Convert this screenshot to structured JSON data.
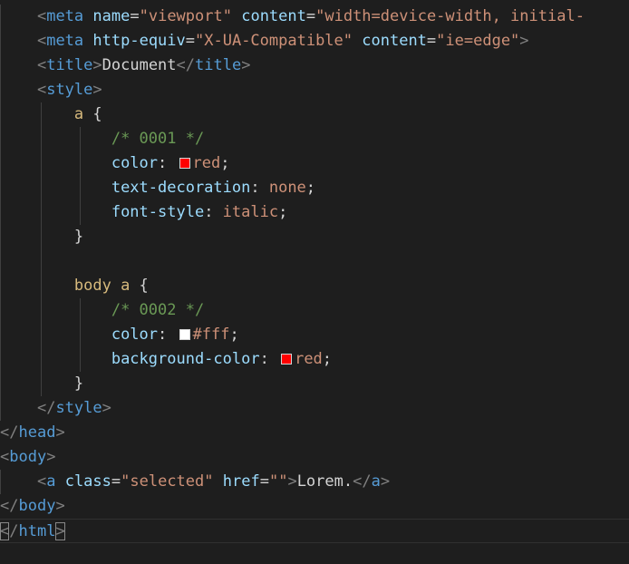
{
  "lines": [
    {
      "indent": 2,
      "tokens": [
        {
          "t": "<",
          "c": "punc"
        },
        {
          "t": "meta",
          "c": "tag"
        },
        {
          "t": " "
        },
        {
          "t": "name",
          "c": "attr"
        },
        {
          "t": "=",
          "c": "eq"
        },
        {
          "t": "\"viewport\"",
          "c": "str"
        },
        {
          "t": " "
        },
        {
          "t": "content",
          "c": "attr"
        },
        {
          "t": "=",
          "c": "eq"
        },
        {
          "t": "\"width=device-width, initial-",
          "c": "str"
        }
      ]
    },
    {
      "indent": 2,
      "tokens": [
        {
          "t": "<",
          "c": "punc"
        },
        {
          "t": "meta",
          "c": "tag"
        },
        {
          "t": " "
        },
        {
          "t": "http-equiv",
          "c": "attr"
        },
        {
          "t": "=",
          "c": "eq"
        },
        {
          "t": "\"X-UA-Compatible\"",
          "c": "str"
        },
        {
          "t": " "
        },
        {
          "t": "content",
          "c": "attr"
        },
        {
          "t": "=",
          "c": "eq"
        },
        {
          "t": "\"ie=edge\"",
          "c": "str"
        },
        {
          "t": ">",
          "c": "punc"
        }
      ]
    },
    {
      "indent": 2,
      "tokens": [
        {
          "t": "<",
          "c": "punc"
        },
        {
          "t": "title",
          "c": "tag"
        },
        {
          "t": ">",
          "c": "punc"
        },
        {
          "t": "Document",
          "c": "text"
        },
        {
          "t": "</",
          "c": "punc"
        },
        {
          "t": "title",
          "c": "tag"
        },
        {
          "t": ">",
          "c": "punc"
        }
      ]
    },
    {
      "indent": 2,
      "tokens": [
        {
          "t": "<",
          "c": "punc"
        },
        {
          "t": "style",
          "c": "tag"
        },
        {
          "t": ">",
          "c": "punc"
        }
      ]
    },
    {
      "indent": 4,
      "tokens": [
        {
          "t": "a",
          "c": "sel"
        },
        {
          "t": " {",
          "c": "text"
        }
      ]
    },
    {
      "indent": 6,
      "tokens": [
        {
          "t": "/* 0001 */",
          "c": "comment"
        }
      ]
    },
    {
      "indent": 6,
      "tokens": [
        {
          "t": "color",
          "c": "prop"
        },
        {
          "t": ": ",
          "c": "text"
        },
        {
          "swatch": "#ff0000"
        },
        {
          "t": "red",
          "c": "val"
        },
        {
          "t": ";",
          "c": "text"
        }
      ]
    },
    {
      "indent": 6,
      "tokens": [
        {
          "t": "text-decoration",
          "c": "prop"
        },
        {
          "t": ": ",
          "c": "text"
        },
        {
          "t": "none",
          "c": "val"
        },
        {
          "t": ";",
          "c": "text"
        }
      ]
    },
    {
      "indent": 6,
      "tokens": [
        {
          "t": "font-style",
          "c": "prop"
        },
        {
          "t": ": ",
          "c": "text"
        },
        {
          "t": "italic",
          "c": "val"
        },
        {
          "t": ";",
          "c": "text"
        }
      ]
    },
    {
      "indent": 4,
      "tokens": [
        {
          "t": "}",
          "c": "text"
        }
      ]
    },
    {
      "indent": 0,
      "tokens": []
    },
    {
      "indent": 4,
      "tokens": [
        {
          "t": "body a",
          "c": "sel"
        },
        {
          "t": " {",
          "c": "text"
        }
      ]
    },
    {
      "indent": 6,
      "tokens": [
        {
          "t": "/* 0002 */",
          "c": "comment"
        }
      ]
    },
    {
      "indent": 6,
      "tokens": [
        {
          "t": "color",
          "c": "prop"
        },
        {
          "t": ": ",
          "c": "text"
        },
        {
          "swatch": "#ffffff"
        },
        {
          "t": "#fff",
          "c": "val"
        },
        {
          "t": ";",
          "c": "text"
        }
      ]
    },
    {
      "indent": 6,
      "tokens": [
        {
          "t": "background-color",
          "c": "prop"
        },
        {
          "t": ": ",
          "c": "text"
        },
        {
          "swatch": "#ff0000"
        },
        {
          "t": "red",
          "c": "val"
        },
        {
          "t": ";",
          "c": "text"
        }
      ]
    },
    {
      "indent": 4,
      "tokens": [
        {
          "t": "}",
          "c": "text"
        }
      ]
    },
    {
      "indent": 2,
      "tokens": [
        {
          "t": "</",
          "c": "punc"
        },
        {
          "t": "style",
          "c": "tag"
        },
        {
          "t": ">",
          "c": "punc"
        }
      ]
    },
    {
      "indent": 0,
      "tokens": [
        {
          "t": "</",
          "c": "punc"
        },
        {
          "t": "head",
          "c": "tag"
        },
        {
          "t": ">",
          "c": "punc"
        }
      ]
    },
    {
      "indent": 0,
      "tokens": [
        {
          "t": "<",
          "c": "punc"
        },
        {
          "t": "body",
          "c": "tag"
        },
        {
          "t": ">",
          "c": "punc"
        }
      ]
    },
    {
      "indent": 2,
      "tokens": [
        {
          "t": "<",
          "c": "punc"
        },
        {
          "t": "a",
          "c": "tag"
        },
        {
          "t": " "
        },
        {
          "t": "class",
          "c": "attr"
        },
        {
          "t": "=",
          "c": "eq"
        },
        {
          "t": "\"selected\"",
          "c": "str"
        },
        {
          "t": " "
        },
        {
          "t": "href",
          "c": "attr"
        },
        {
          "t": "=",
          "c": "eq"
        },
        {
          "t": "\"\"",
          "c": "str"
        },
        {
          "t": ">",
          "c": "punc"
        },
        {
          "t": "Lorem.",
          "c": "text"
        },
        {
          "t": "</",
          "c": "punc"
        },
        {
          "t": "a",
          "c": "tag"
        },
        {
          "t": ">",
          "c": "punc"
        }
      ]
    },
    {
      "indent": 0,
      "tokens": [
        {
          "t": "</",
          "c": "punc"
        },
        {
          "t": "body",
          "c": "tag"
        },
        {
          "t": ">",
          "c": "punc"
        }
      ]
    },
    {
      "indent": 0,
      "current": true,
      "tokens": [
        {
          "t": "<",
          "c": "punc",
          "match": true
        },
        {
          "t": "/",
          "c": "punc"
        },
        {
          "t": "html",
          "c": "tag"
        },
        {
          "t": ">",
          "c": "punc",
          "match": true
        }
      ]
    }
  ],
  "colors": {
    "background": "#1e1e1e",
    "tag": "#569cd6",
    "attribute": "#9cdcfe",
    "string": "#ce9178",
    "selector": "#d7ba7d",
    "comment": "#6a9955",
    "punctuation": "#808080",
    "text": "#d4d4d4"
  }
}
